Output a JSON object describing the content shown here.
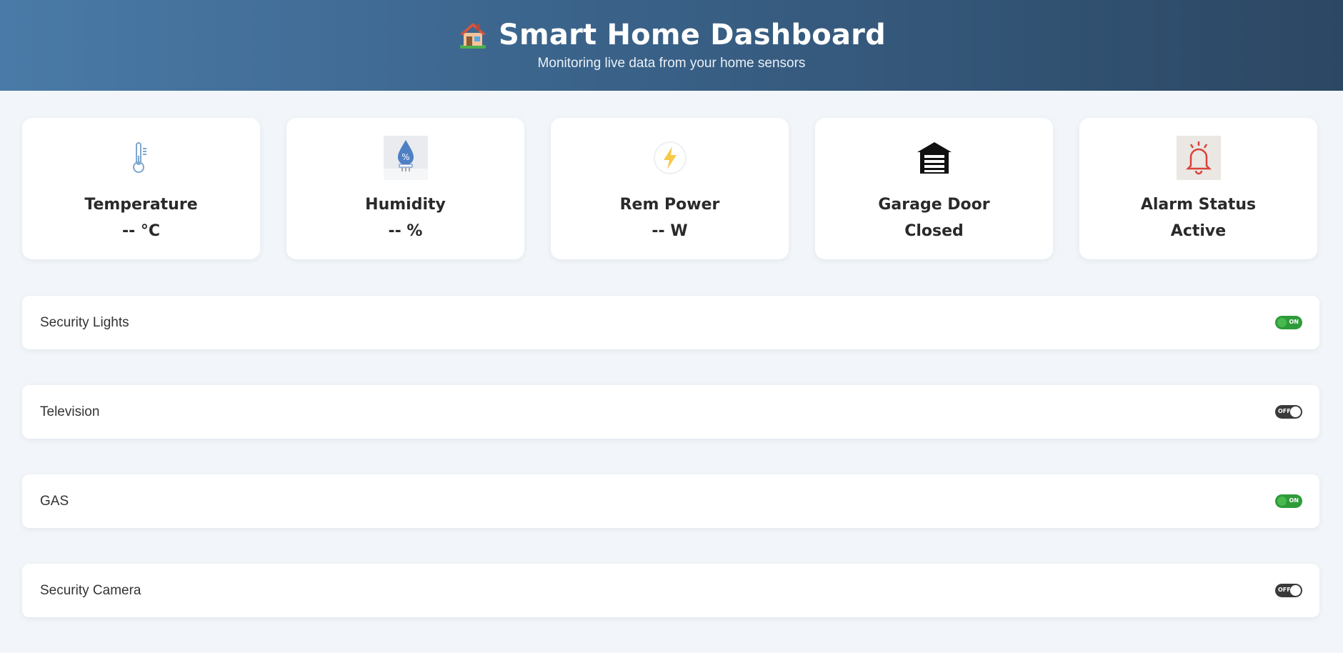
{
  "header": {
    "title": "Smart Home Dashboard",
    "subtitle": "Monitoring live data from your home sensors",
    "icon": "house-icon"
  },
  "cards": [
    {
      "label": "Temperature",
      "value": "-- °C",
      "icon": "thermometer-icon"
    },
    {
      "label": "Humidity",
      "value": "-- %",
      "icon": "humidity-icon"
    },
    {
      "label": "Rem Power",
      "value": "-- W",
      "icon": "lightning-icon"
    },
    {
      "label": "Garage Door",
      "value": "Closed",
      "icon": "garage-icon"
    },
    {
      "label": "Alarm Status",
      "value": "Active",
      "icon": "bell-icon"
    }
  ],
  "devices": [
    {
      "name": "Security Lights",
      "state": "ON"
    },
    {
      "name": "Television",
      "state": "OFF"
    },
    {
      "name": "GAS",
      "state": "ON"
    },
    {
      "name": "Security Camera",
      "state": "OFF"
    }
  ],
  "colors": {
    "header_start": "#4a7aa7",
    "header_end": "#2c4763",
    "toggle_on": "#2e9b3a",
    "toggle_off": "#3a3a3a",
    "page_bg": "#f2f6fa"
  }
}
